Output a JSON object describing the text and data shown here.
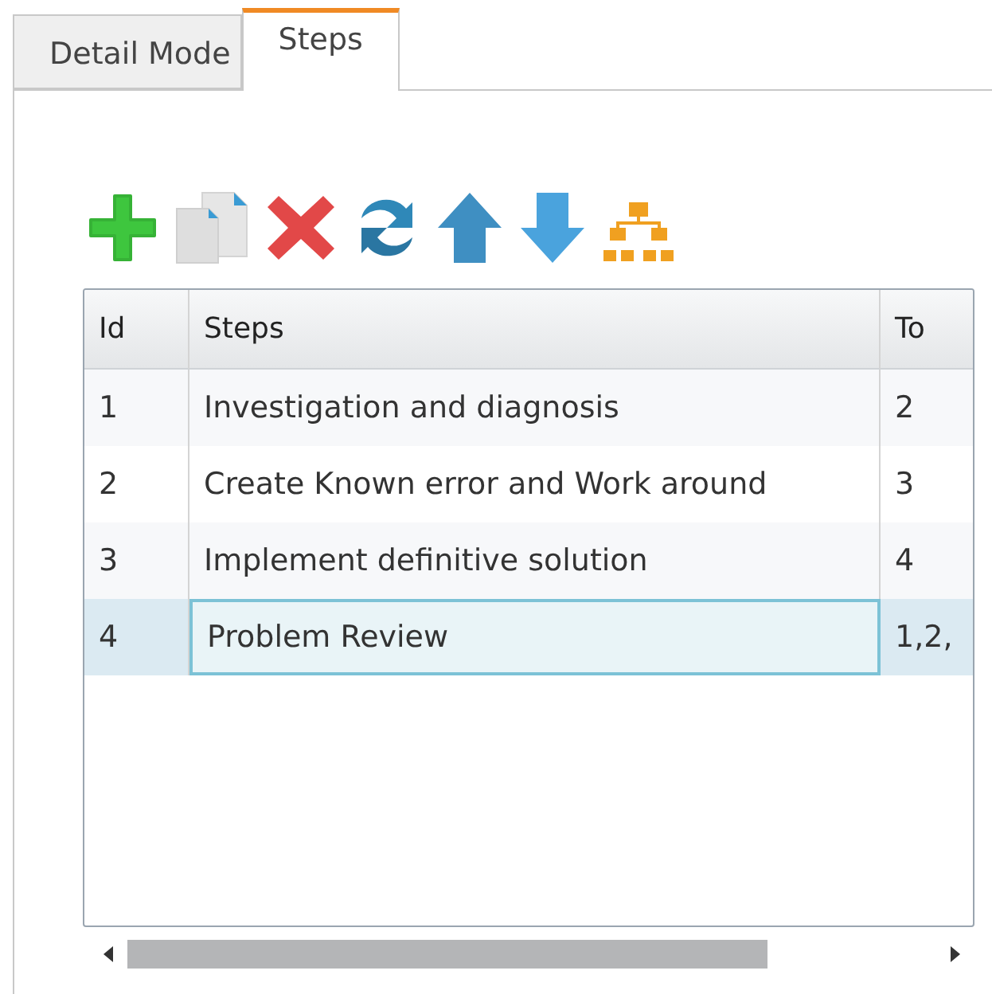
{
  "tabs": [
    {
      "label": "Detail Mode",
      "selected": false
    },
    {
      "label": "Steps",
      "selected": true
    }
  ],
  "table": {
    "columns": [
      "Id",
      "Steps",
      "To"
    ],
    "rows": [
      {
        "id": "1",
        "steps": "Investigation and diagnosis",
        "to": "2",
        "selected": false
      },
      {
        "id": "2",
        "steps": "Create Known error and Work around",
        "to": "3",
        "selected": false
      },
      {
        "id": "3",
        "steps": "Implement definitive solution",
        "to": "4",
        "selected": false
      },
      {
        "id": "4",
        "steps": "Problem Review",
        "to": "1,2,",
        "selected": true
      }
    ]
  }
}
